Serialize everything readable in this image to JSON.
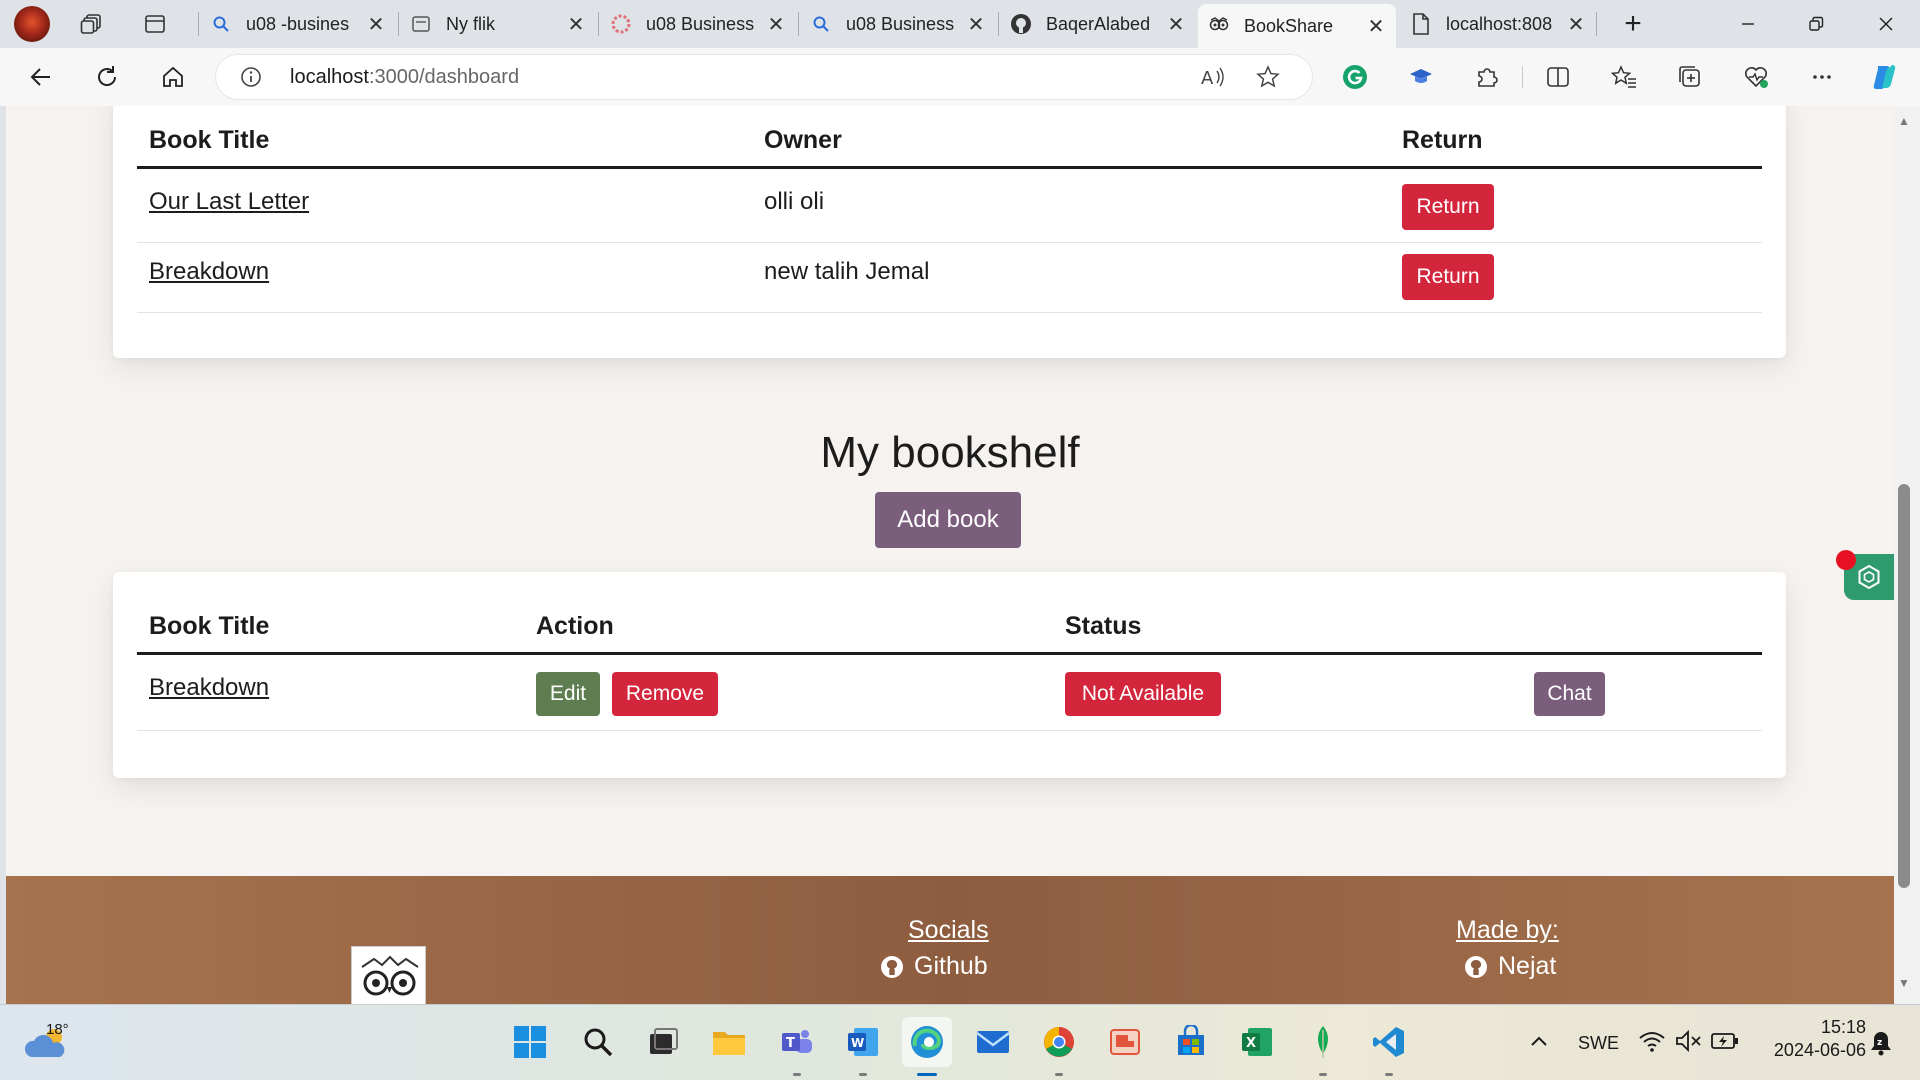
{
  "browser": {
    "tabs": [
      {
        "title": "u08 -busines",
        "icon": "search-icon",
        "active": false
      },
      {
        "title": "Ny flik",
        "icon": "new-tab-page-icon",
        "active": false
      },
      {
        "title": "u08 Business",
        "icon": "red-dots-icon",
        "active": false
      },
      {
        "title": "u08 Business",
        "icon": "search-icon",
        "active": false
      },
      {
        "title": "BaqerAlabed",
        "icon": "github-icon",
        "active": false
      },
      {
        "title": "BookShare",
        "icon": "owl-icon",
        "active": true
      },
      {
        "title": "localhost:808",
        "icon": "page-icon",
        "active": false
      }
    ],
    "url_host": "localhost",
    "url_path": ":3000/dashboard"
  },
  "borrowed": {
    "headers": {
      "title": "Book Title",
      "owner": "Owner",
      "return": "Return"
    },
    "rows": [
      {
        "title": "Our Last Letter",
        "owner": "olli oli",
        "action": "Return"
      },
      {
        "title": "Breakdown",
        "owner": "new talih Jemal",
        "action": "Return"
      }
    ]
  },
  "bookshelf": {
    "heading": "My bookshelf",
    "add_label": "Add book",
    "headers": {
      "title": "Book Title",
      "action": "Action",
      "status": "Status"
    },
    "rows": [
      {
        "title": "Breakdown",
        "edit": "Edit",
        "remove": "Remove",
        "status": "Not Available",
        "chat": "Chat"
      }
    ]
  },
  "footer": {
    "socials_heading": "Socials",
    "social_link": "Github",
    "madeby_heading": "Made by:",
    "author_link": "Nejat"
  },
  "taskbar": {
    "weather_temp": "18°",
    "language": "SWE",
    "time": "15:18",
    "date": "2024-06-06"
  },
  "colors": {
    "danger": "#d3263d",
    "success": "#5e7d50",
    "accent": "#7b5d7c",
    "footer": "#9a6a48",
    "page_bg": "#f5f2ef"
  }
}
